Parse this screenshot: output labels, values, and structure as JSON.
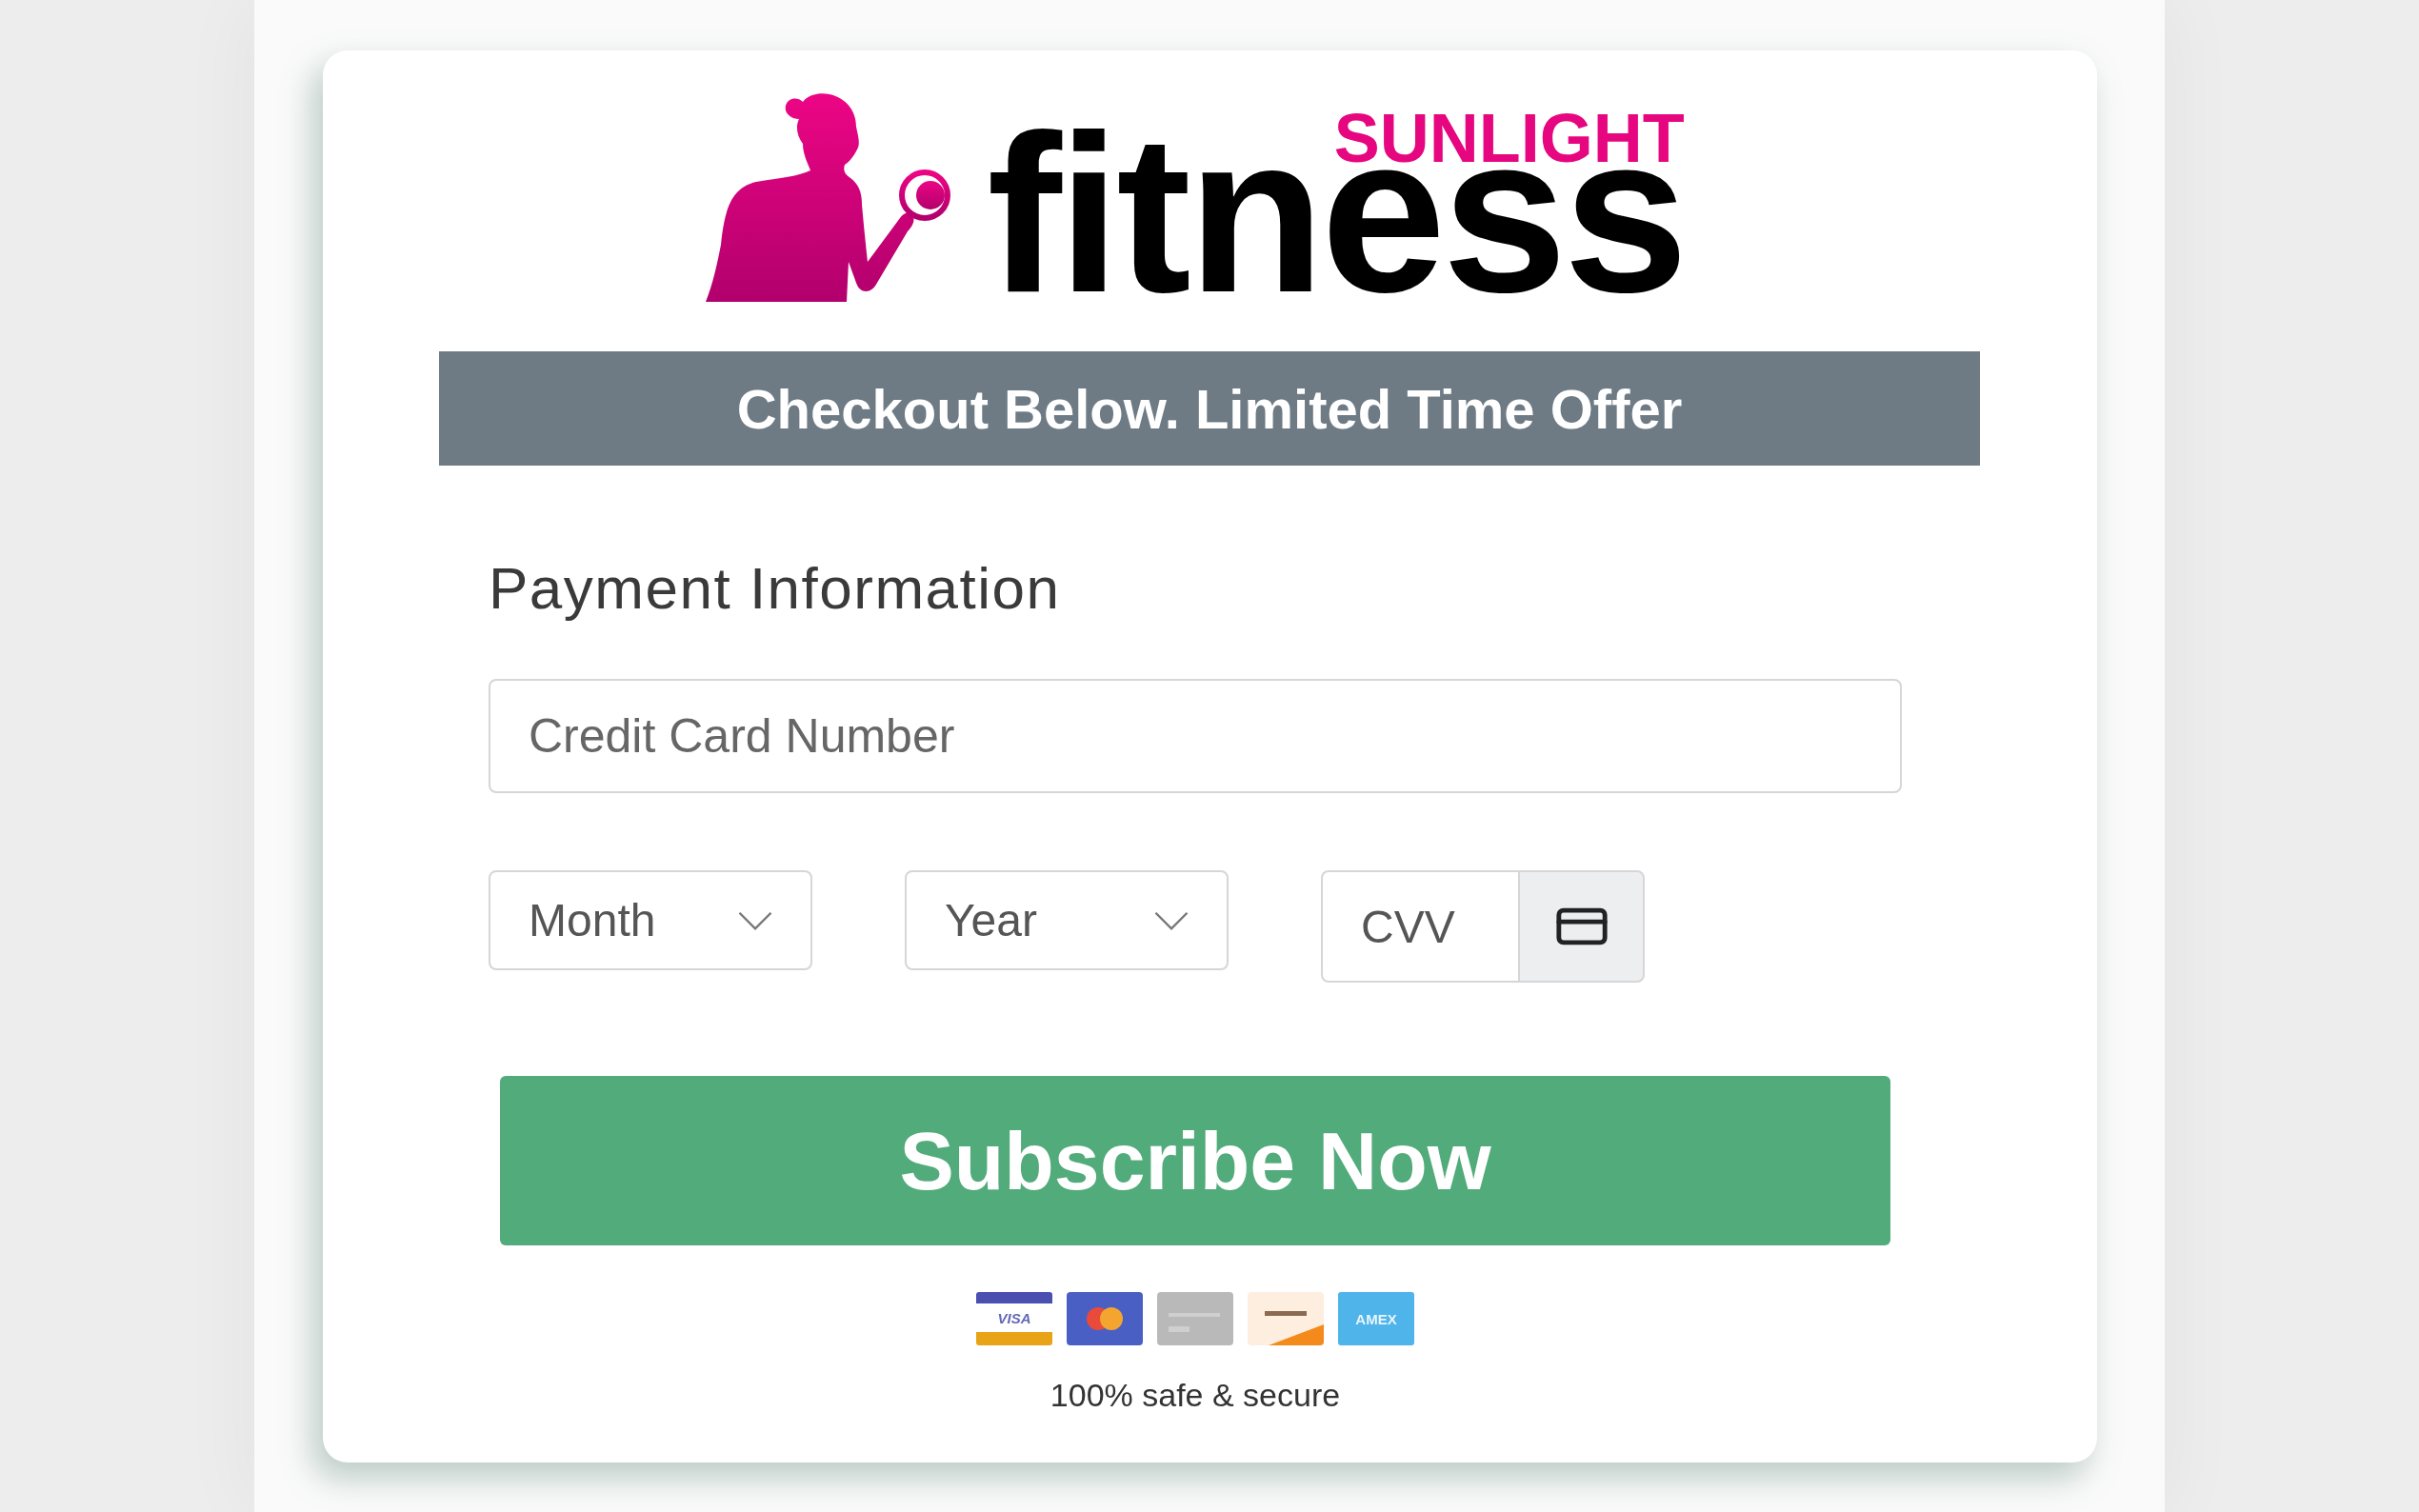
{
  "logo": {
    "brand_top": "SUNLIGHT",
    "brand_main": "fitness"
  },
  "banner": {
    "text": "Checkout Below. Limited Time Offer"
  },
  "payment": {
    "heading": "Payment Information",
    "card_number": {
      "placeholder": "Credit Card Number"
    },
    "month": {
      "placeholder": "Month"
    },
    "year": {
      "placeholder": "Year"
    },
    "cvv": {
      "placeholder": "CVV"
    },
    "submit": {
      "label": "Subscribe Now"
    }
  },
  "accepted_cards": [
    {
      "kind": "stripes",
      "label": "VISA"
    },
    {
      "kind": "circles"
    },
    {
      "kind": "grey"
    },
    {
      "kind": "corner"
    },
    {
      "kind": "tile",
      "label": "AMEX"
    }
  ],
  "security_note": "100% safe & secure"
}
